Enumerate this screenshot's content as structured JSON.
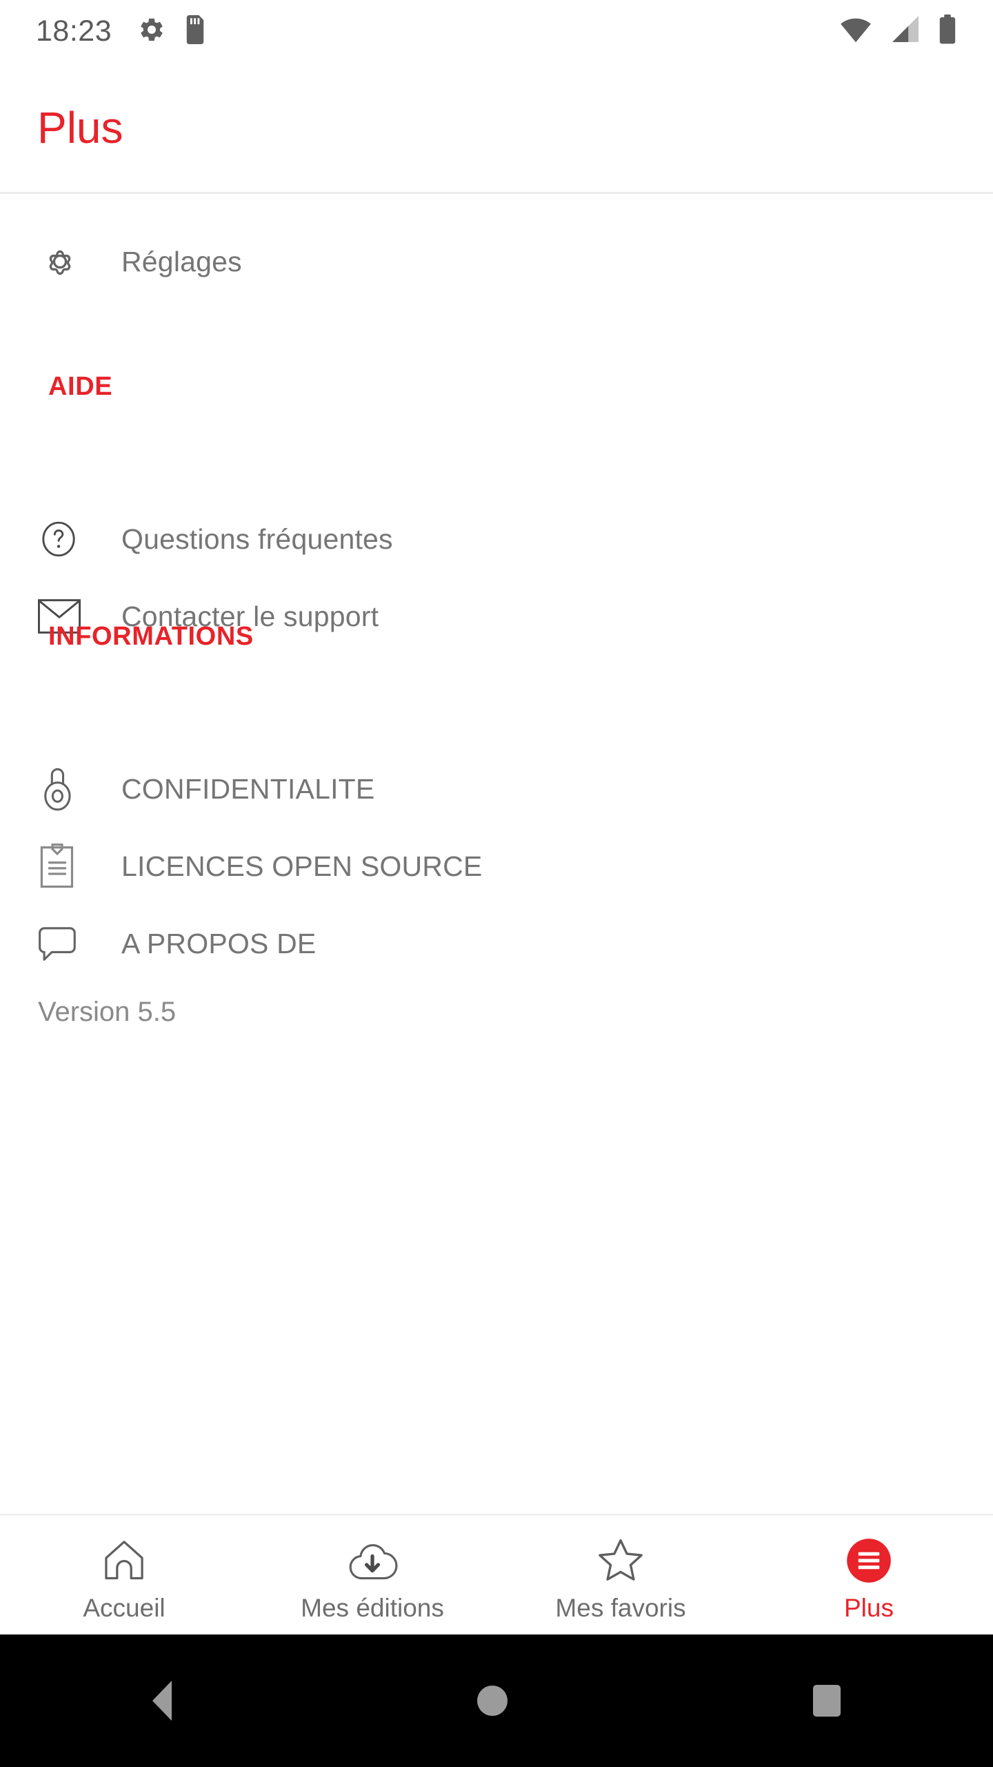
{
  "statusbar": {
    "time": "18:23",
    "icons_left": [
      "gear-icon",
      "sd-card-icon"
    ],
    "icons_right": [
      "wifi-icon",
      "signal-icon",
      "battery-icon"
    ]
  },
  "header": {
    "title": "Plus"
  },
  "colors": {
    "accent_red": "#E8232A",
    "label_gray": "#757575",
    "icon_gray": "#636363",
    "divider": "#ececec"
  },
  "main": {
    "settings_row": {
      "label": "Réglages",
      "icon": "gear-icon"
    },
    "sections": [
      {
        "heading": "AIDE",
        "items": [
          {
            "label": "Questions fréquentes",
            "icon": "question-circle-icon"
          },
          {
            "label": "Contacter le support",
            "icon": "envelope-icon"
          }
        ]
      },
      {
        "heading": "INFORMATIONS",
        "items": [
          {
            "label": "CONFIDENTIALITE",
            "icon": "padlock-icon"
          },
          {
            "label": "LICENCES OPEN SOURCE",
            "icon": "clipboard-icon"
          },
          {
            "label": "A PROPOS DE",
            "icon": "speech-bubble-icon"
          }
        ]
      }
    ],
    "version": "Version 5.5"
  },
  "bottomnav": {
    "items": [
      {
        "label": "Accueil",
        "icon": "home-icon",
        "active": false
      },
      {
        "label": "Mes éditions",
        "icon": "cloud-download-icon",
        "active": false
      },
      {
        "label": "Mes favoris",
        "icon": "star-icon",
        "active": false
      },
      {
        "label": "Plus",
        "icon": "hamburger-menu-icon",
        "active": true
      }
    ]
  },
  "sysnav": {
    "buttons": [
      "back-button",
      "home-button",
      "recents-button"
    ]
  }
}
